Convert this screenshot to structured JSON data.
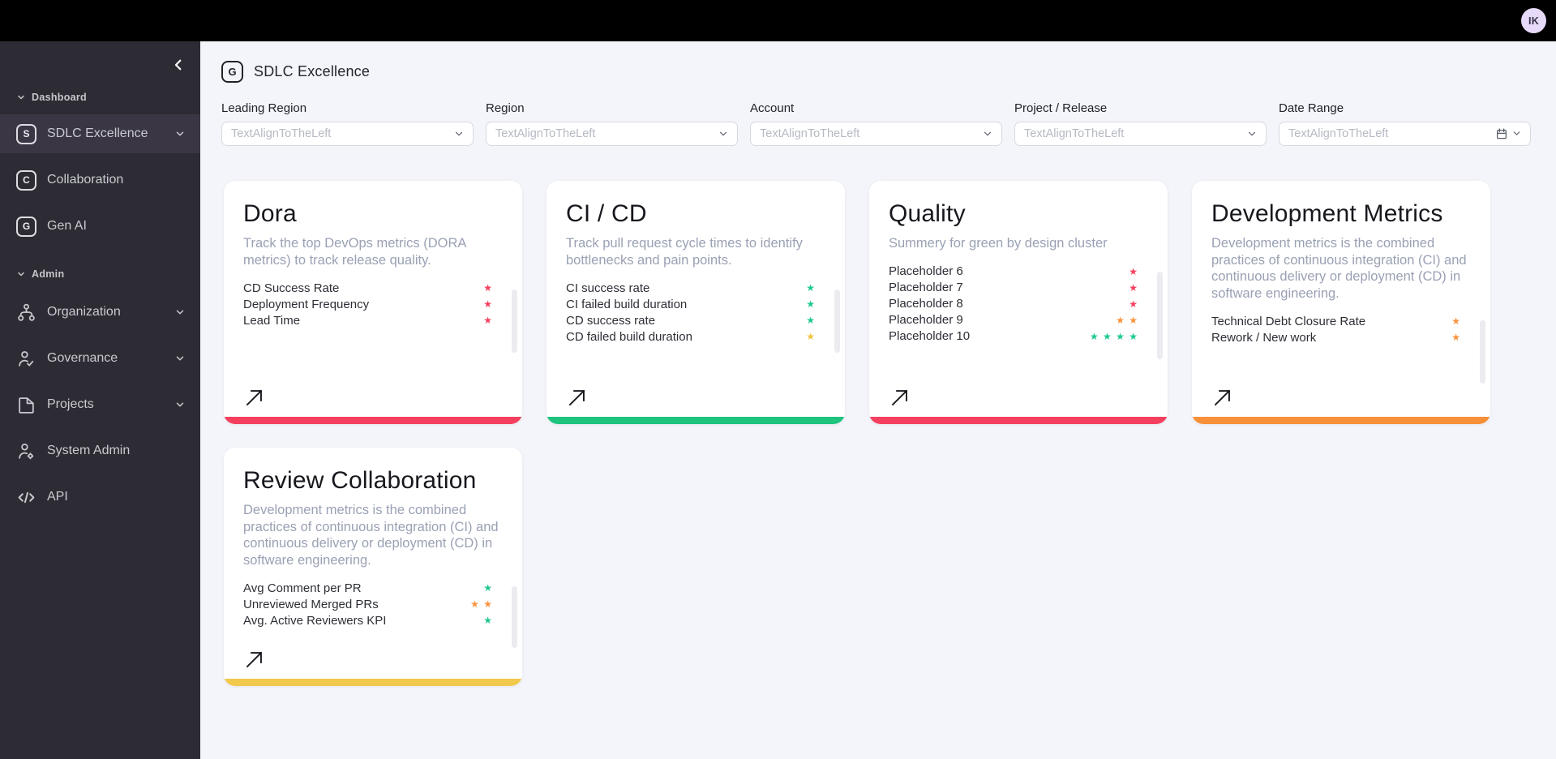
{
  "topbar": {
    "avatar_initials": "IK"
  },
  "sidebar": {
    "sections": [
      {
        "label": "Dashboard",
        "items": [
          {
            "label": "SDLC Excellence",
            "icon_letter": "S"
          },
          {
            "label": "Collaboration",
            "icon_letter": "C"
          },
          {
            "label": "Gen AI",
            "icon_letter": "G"
          }
        ]
      },
      {
        "label": "Admin",
        "items": [
          {
            "label": "Organization"
          },
          {
            "label": "Governance"
          },
          {
            "label": "Projects"
          },
          {
            "label": "System Admin"
          },
          {
            "label": "API"
          }
        ]
      }
    ]
  },
  "header": {
    "logo_letter": "G",
    "title": "SDLC Excellence"
  },
  "filters": [
    {
      "label": "Leading Region",
      "placeholder": "TextAlignToTheLeft"
    },
    {
      "label": "Region",
      "placeholder": "TextAlignToTheLeft"
    },
    {
      "label": "Account",
      "placeholder": "TextAlignToTheLeft"
    },
    {
      "label": "Project / Release",
      "placeholder": "TextAlignToTheLeft"
    },
    {
      "label": "Date Range",
      "placeholder": "TextAlignToTheLeft"
    }
  ],
  "status_colors": {
    "rose": "#f43f5e",
    "green": "#1ec98b",
    "orange": "#fb923c",
    "amber": "#f2c33e",
    "yellow": "#f2c94c"
  },
  "cards": [
    {
      "title": "Dora",
      "description": "Track the top DevOps metrics (DORA metrics) to track release quality.",
      "accent": "#f43f5e",
      "metrics": [
        {
          "name": "CD Success Rate",
          "stars": "★",
          "star_color": "#f43f5e"
        },
        {
          "name": "Deployment Frequency",
          "stars": "★",
          "star_color": "#f43f5e"
        },
        {
          "name": "Lead Time",
          "stars": "★",
          "star_color": "#f43f5e"
        }
      ]
    },
    {
      "title": "CI / CD",
      "description": "Track pull request cycle times to identify bottlenecks and pain points.",
      "accent": "#1ec37d",
      "metrics": [
        {
          "name": "CI success rate",
          "stars": "★",
          "star_color": "#1ec98b"
        },
        {
          "name": "CI failed build duration",
          "stars": "★",
          "star_color": "#1ec98b"
        },
        {
          "name": "CD success rate",
          "stars": "★",
          "star_color": "#1ec98b"
        },
        {
          "name": "CD failed build duration",
          "stars": "★",
          "star_color": "#f2c33e"
        }
      ]
    },
    {
      "title": "Quality",
      "description": "Summery for green by design cluster",
      "accent": "#f43f5e",
      "metrics": [
        {
          "name": "Placeholder 6",
          "stars": "★",
          "star_color": "#f43f5e"
        },
        {
          "name": "Placeholder 7",
          "stars": "★",
          "star_color": "#f43f5e"
        },
        {
          "name": "Placeholder 8",
          "stars": "★",
          "star_color": "#f43f5e"
        },
        {
          "name": "Placeholder 9",
          "stars": "★ ★",
          "star_color": "#fb923c"
        },
        {
          "name": "Placeholder 10",
          "stars": "★ ★ ★ ★",
          "star_color": "#1ec98b"
        }
      ]
    },
    {
      "title": "Development Metrics",
      "description": "Development metrics is the combined practices of continuous integration (CI) and continuous delivery or deployment (CD) in software engineering.",
      "accent": "#f79038",
      "metrics": [
        {
          "name": "Technical Debt Closure Rate",
          "stars": "★",
          "star_color": "#fb923c"
        },
        {
          "name": "Rework / New work",
          "stars": "★",
          "star_color": "#fb923c"
        }
      ]
    },
    {
      "title": "Review Collaboration",
      "description": "Development metrics is the combined practices of continuous integration (CI) and continuous delivery or deployment (CD) in software engineering.",
      "accent": "#f2c94c",
      "metrics": [
        {
          "name": "Avg Comment per PR",
          "stars": "★",
          "star_color": "#1ec98b"
        },
        {
          "name": "Unreviewed Merged PRs",
          "stars": "★ ★",
          "star_color": "#fb923c"
        },
        {
          "name": "Avg. Active Reviewers KPI",
          "stars": "★",
          "star_color": "#1ec98b"
        }
      ]
    }
  ]
}
